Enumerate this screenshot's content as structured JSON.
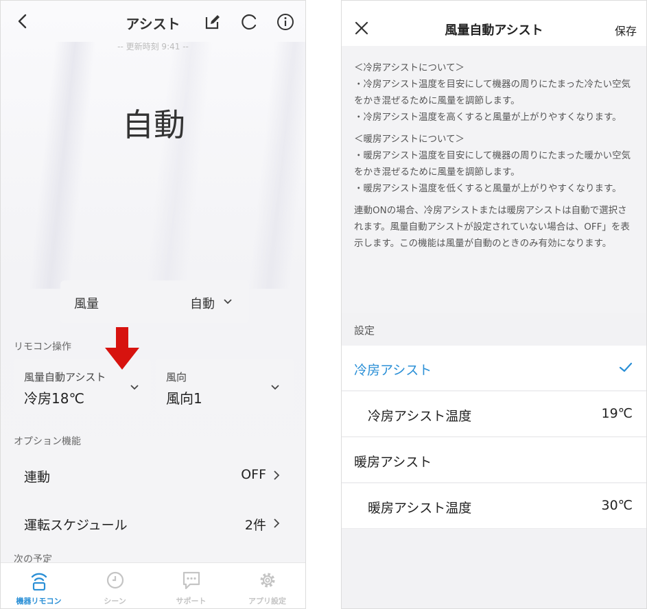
{
  "left_screen": {
    "header": {
      "title": "アシスト",
      "updated": "-- 更新時刻 9:41 --"
    },
    "mode": "自動",
    "wind_volume": {
      "label": "風量",
      "value": "自動"
    },
    "remote_section": {
      "label": "リモコン操作",
      "cards": [
        {
          "title": "風量自動アシスト",
          "value": "冷房18℃"
        },
        {
          "title": "風向",
          "value": "風向1"
        }
      ]
    },
    "options_section": {
      "label": "オプション機能",
      "rows": [
        {
          "label": "連動",
          "value": "OFF"
        },
        {
          "label": "運転スケジュール",
          "value": "2件"
        }
      ],
      "next_schedule_label": "次の予定"
    },
    "tabbar": [
      {
        "label": "機器リモコン",
        "icon": "remote-wifi-icon",
        "active": true
      },
      {
        "label": "シーン",
        "icon": "clock-icon",
        "active": false
      },
      {
        "label": "サポート",
        "icon": "chat-icon",
        "active": false
      },
      {
        "label": "アプリ設定",
        "icon": "gear-icon",
        "active": false
      }
    ],
    "colors": {
      "accent": "#2a8fd6",
      "annotation_arrow": "#d7130f"
    }
  },
  "right_screen": {
    "header": {
      "title": "風量自動アシスト",
      "save_label": "保存"
    },
    "description": [
      "＜冷房アシストについて＞\n・冷房アシスト温度を目安にして機器の周りにたまった冷たい空気をかき混ぜるために風量を調節します。\n・冷房アシスト温度を高くすると風量が上がりやすくなります。",
      "＜暖房アシストについて＞\n・暖房アシスト温度を目安にして機器の周りにたまった暖かい空気をかき混ぜるために風量を調節します。\n・暖房アシスト温度を低くすると風量が上がりやすくなります。",
      "連動ONの場合、冷房アシストまたは暖房アシストは自動で選択されます。風量自動アシストが設定されていない場合は、OFF」を表示します。この機能は風量が自動のときのみ有効になります。"
    ],
    "settings_label": "設定",
    "settings": [
      {
        "label": "冷房アシスト",
        "value": "",
        "selected": true
      },
      {
        "label": "冷房アシスト温度",
        "value": "19℃",
        "selected": false
      },
      {
        "label": "暖房アシスト",
        "value": "",
        "selected": false
      },
      {
        "label": "暖房アシスト温度",
        "value": "30℃",
        "selected": false
      }
    ]
  }
}
